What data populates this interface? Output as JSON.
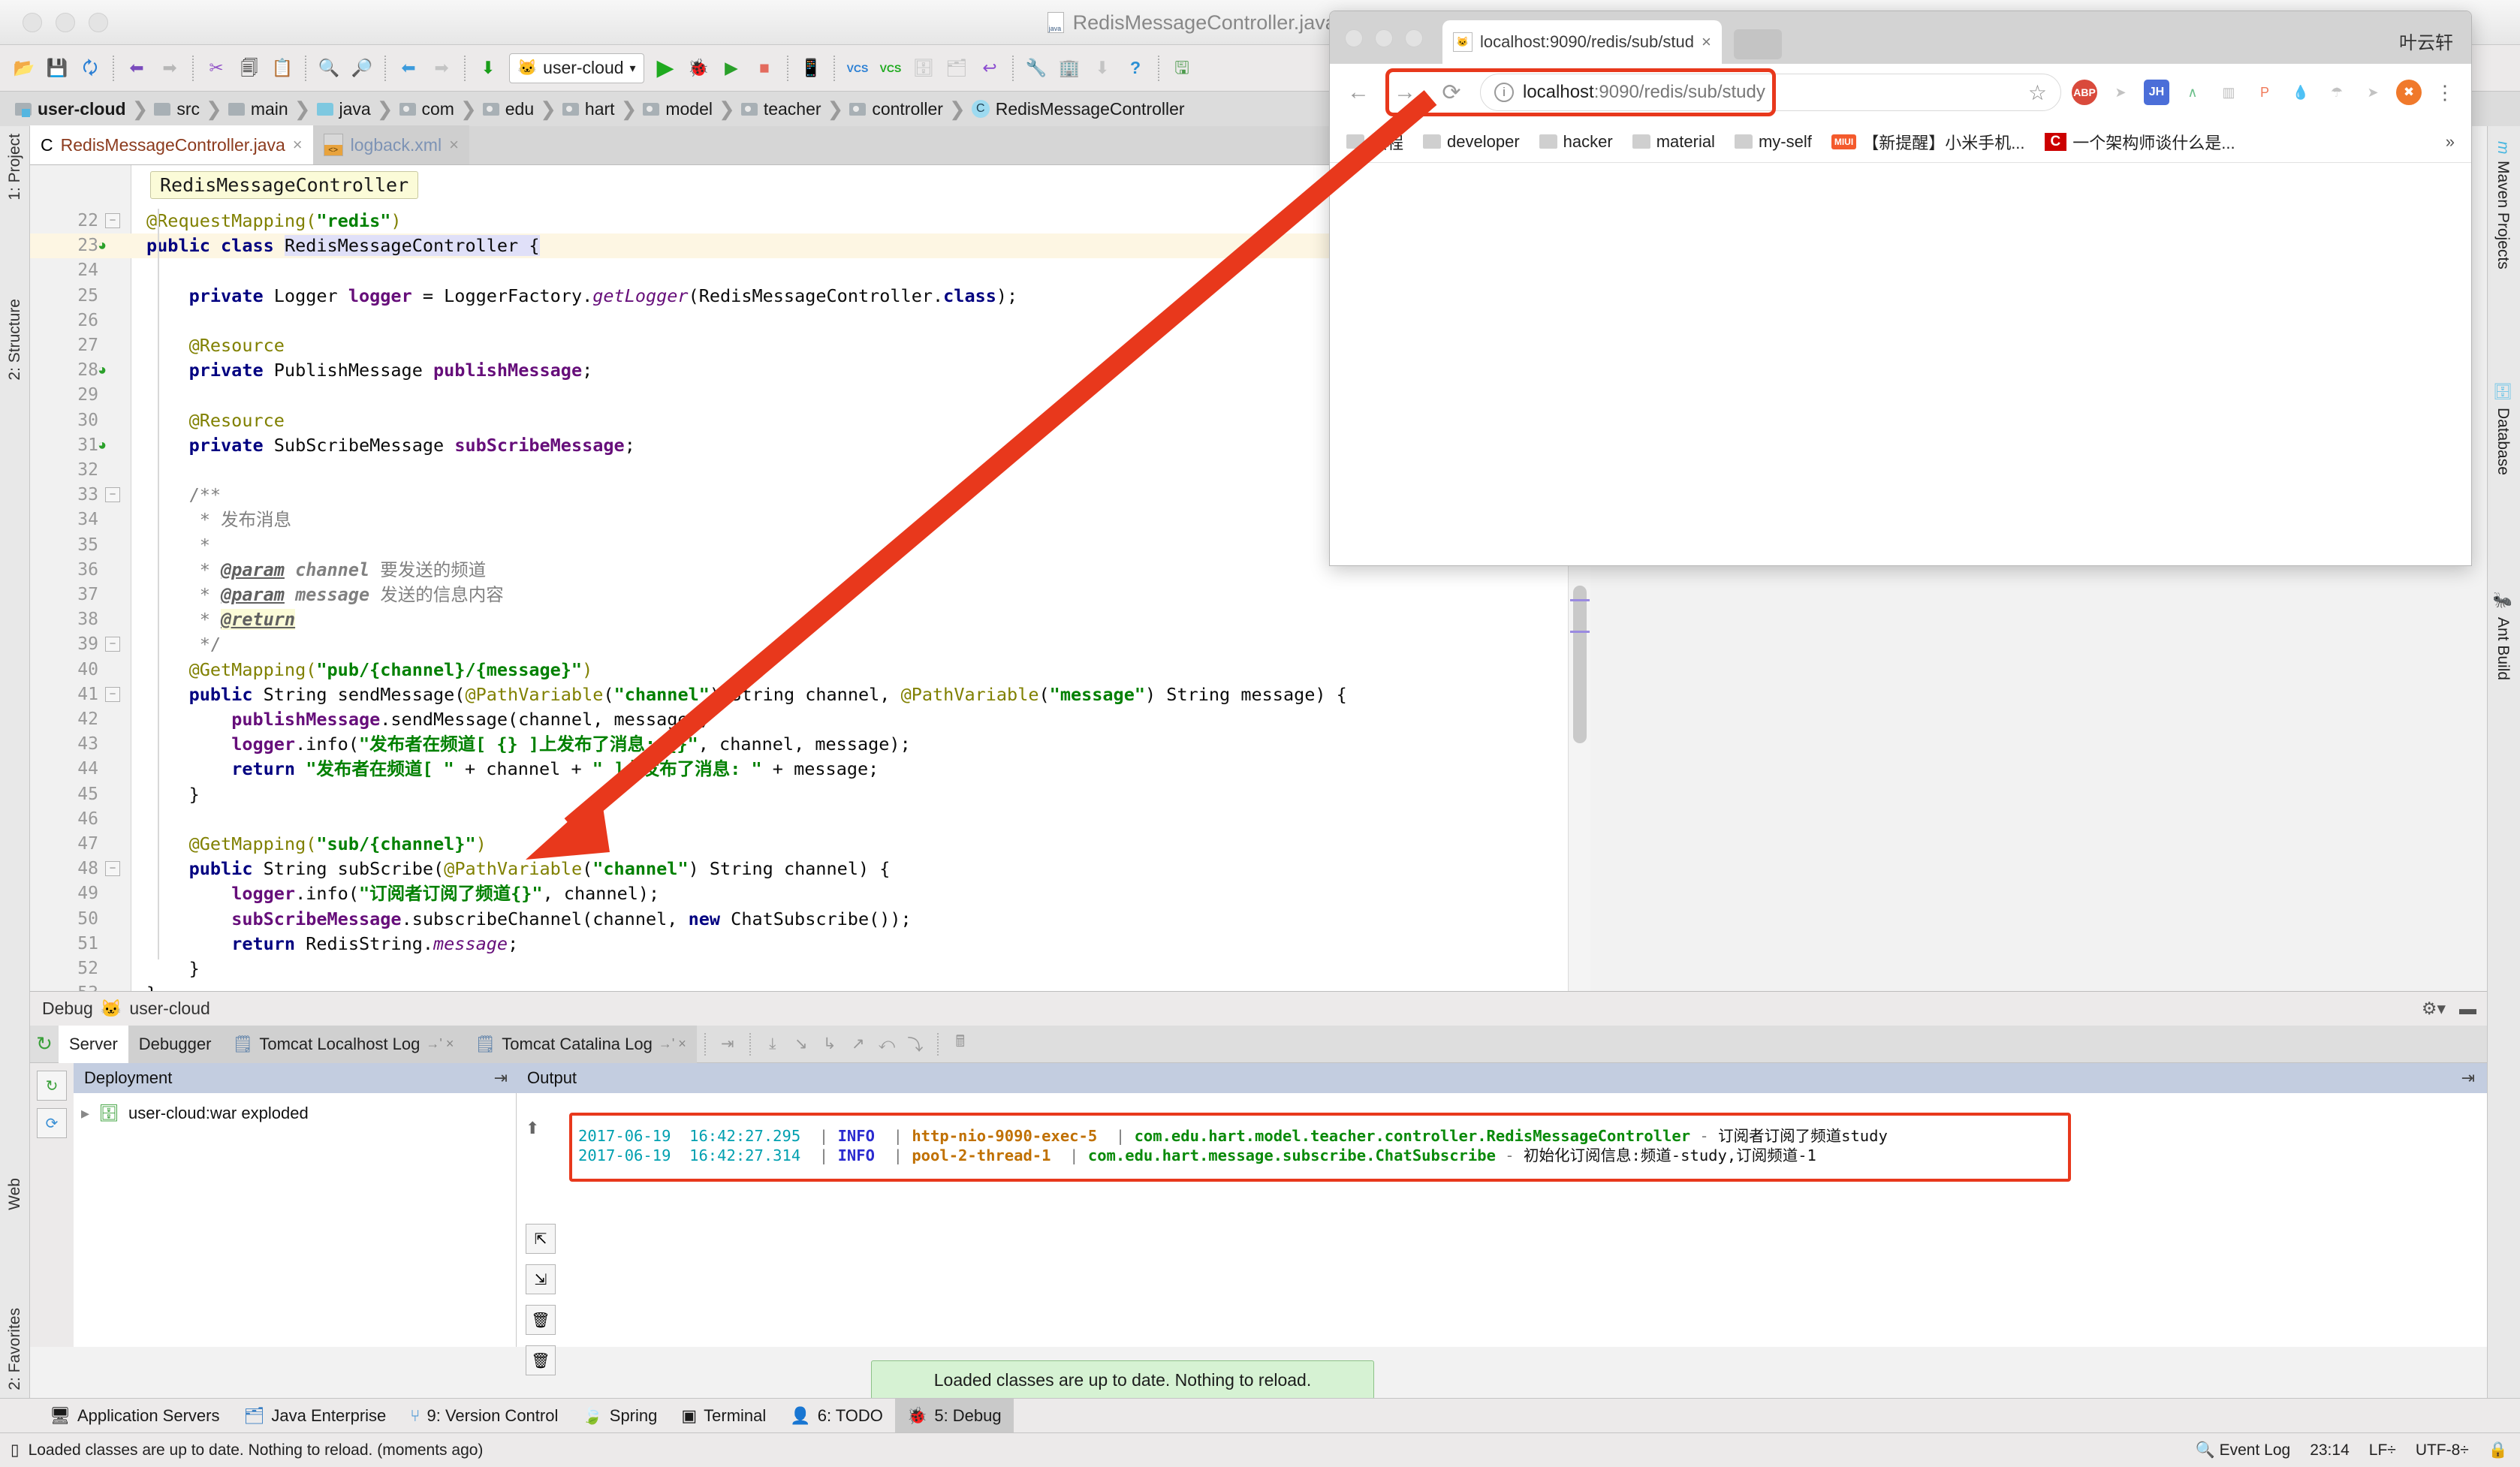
{
  "window": {
    "title": "RedisMessageController.java - user-cloud - [",
    "file_icon": "java-file-icon"
  },
  "toolbar": {
    "icons": [
      "open-folder-icon",
      "save-icon",
      "sync-icon",
      "undo-icon",
      "redo-icon",
      "cut-icon",
      "copy-icon",
      "paste-icon",
      "find-icon",
      "replace-icon",
      "back-icon",
      "forward-icon",
      "compile-icon"
    ],
    "module_selector": "user-cloud",
    "run_icon": "run-icon",
    "debug_icon": "debug-icon",
    "coverage_icon": "run-coverage-icon",
    "stop_icon": "stop-icon",
    "vcs_update_label": "VCS",
    "vcs_commit_label": "VCS",
    "help_icon": "help-icon"
  },
  "breadcrumb": {
    "items": [
      {
        "label": "user-cloud",
        "icon": "project-icon",
        "bold": true
      },
      {
        "label": "src",
        "icon": "folder-icon",
        "bold": false
      },
      {
        "label": "main",
        "icon": "folder-icon",
        "bold": false
      },
      {
        "label": "java",
        "icon": "source-folder-icon",
        "bold": false
      },
      {
        "label": "com",
        "icon": "package-icon",
        "bold": false
      },
      {
        "label": "edu",
        "icon": "package-icon",
        "bold": false
      },
      {
        "label": "hart",
        "icon": "package-icon",
        "bold": false
      },
      {
        "label": "model",
        "icon": "package-icon",
        "bold": false
      },
      {
        "label": "teacher",
        "icon": "package-icon",
        "bold": false
      },
      {
        "label": "controller",
        "icon": "package-icon",
        "bold": false
      },
      {
        "label": "RedisMessageController",
        "icon": "class-icon",
        "bold": false
      }
    ]
  },
  "left_rail": {
    "items": [
      "1: Project",
      "2: Structure",
      "2: Favorites",
      "Web"
    ]
  },
  "right_rail": {
    "items": [
      "Maven Projects",
      "Database",
      "Ant Build"
    ]
  },
  "editor": {
    "tabs": [
      {
        "label": "RedisMessageController.java",
        "icon": "java-class-icon",
        "active": true,
        "close": "×"
      },
      {
        "label": "logback.xml",
        "icon": "xml-file-icon",
        "active": false,
        "close": "×"
      }
    ],
    "breadcrumb_hint": "RedisMessageController",
    "lines": [
      {
        "n": "22",
        "indent": 1,
        "fold": "minus",
        "segs": [
          {
            "t": "@RequestMapping(",
            "c": "ann"
          },
          {
            "t": "\"redis\"",
            "c": "str"
          },
          {
            "t": ")",
            "c": "ann"
          }
        ]
      },
      {
        "n": "23",
        "highlight": true,
        "gmark": "class-marker-icon",
        "segs": [
          {
            "t": "public class ",
            "c": "kw"
          },
          {
            "t": "RedisMessageController {",
            "c": "sel"
          }
        ]
      },
      {
        "n": "24",
        "segs": []
      },
      {
        "n": "25",
        "segs": [
          {
            "t": "    ",
            "c": ""
          },
          {
            "t": "private ",
            "c": "kw"
          },
          {
            "t": "Logger ",
            "c": ""
          },
          {
            "t": "logger",
            "c": "fld"
          },
          {
            "t": " = LoggerFactory.",
            "c": ""
          },
          {
            "t": "getLogger",
            "c": "stat"
          },
          {
            "t": "(RedisMessageController.",
            "c": ""
          },
          {
            "t": "class",
            "c": "kw"
          },
          {
            "t": ");",
            "c": ""
          }
        ]
      },
      {
        "n": "26",
        "segs": []
      },
      {
        "n": "27",
        "segs": [
          {
            "t": "    @Resource",
            "c": "ann"
          }
        ]
      },
      {
        "n": "28",
        "gmark": "bean-marker-icon",
        "segs": [
          {
            "t": "    ",
            "c": ""
          },
          {
            "t": "private ",
            "c": "kw"
          },
          {
            "t": "PublishMessage ",
            "c": ""
          },
          {
            "t": "publishMessage",
            "c": "fld"
          },
          {
            "t": ";",
            "c": ""
          }
        ]
      },
      {
        "n": "29",
        "segs": []
      },
      {
        "n": "30",
        "segs": [
          {
            "t": "    @Resource",
            "c": "ann"
          }
        ]
      },
      {
        "n": "31",
        "gmark": "bean-marker-icon",
        "segs": [
          {
            "t": "    ",
            "c": ""
          },
          {
            "t": "private ",
            "c": "kw"
          },
          {
            "t": "SubScribeMessage ",
            "c": ""
          },
          {
            "t": "subScribeMessage",
            "c": "fld"
          },
          {
            "t": ";",
            "c": ""
          }
        ]
      },
      {
        "n": "32",
        "segs": []
      },
      {
        "n": "33",
        "fold": "minus",
        "segs": [
          {
            "t": "    /**",
            "c": "cmt"
          }
        ]
      },
      {
        "n": "34",
        "segs": [
          {
            "t": "     * 发布消息",
            "c": "cmt"
          }
        ]
      },
      {
        "n": "35",
        "segs": [
          {
            "t": "     *",
            "c": "cmt"
          }
        ]
      },
      {
        "n": "36",
        "segs": [
          {
            "t": "     * ",
            "c": "cmt"
          },
          {
            "t": "@param",
            "c": "cmt-tag"
          },
          {
            "t": " ",
            "c": "cmt"
          },
          {
            "t": "channel",
            "c": "cmt-b"
          },
          {
            "t": " 要发送的频道",
            "c": "cmt"
          }
        ]
      },
      {
        "n": "37",
        "segs": [
          {
            "t": "     * ",
            "c": "cmt"
          },
          {
            "t": "@param",
            "c": "cmt-tag"
          },
          {
            "t": " ",
            "c": "cmt"
          },
          {
            "t": "message",
            "c": "cmt-b"
          },
          {
            "t": " 发送的信息内容",
            "c": "cmt"
          }
        ]
      },
      {
        "n": "38",
        "segs": [
          {
            "t": "     * ",
            "c": "cmt"
          },
          {
            "t": "@return",
            "c": "cmt-tag-hl"
          }
        ]
      },
      {
        "n": "39",
        "fold": "minus",
        "segs": [
          {
            "t": "     */",
            "c": "cmt"
          }
        ]
      },
      {
        "n": "40",
        "segs": [
          {
            "t": "    @GetMapping(",
            "c": "ann"
          },
          {
            "t": "\"pub/{channel}/{message}\"",
            "c": "str"
          },
          {
            "t": ")",
            "c": "ann"
          }
        ]
      },
      {
        "n": "41",
        "fold": "minus",
        "segs": [
          {
            "t": "    ",
            "c": ""
          },
          {
            "t": "public ",
            "c": "kw"
          },
          {
            "t": "String sendMessage(",
            "c": ""
          },
          {
            "t": "@PathVariable",
            "c": "ann"
          },
          {
            "t": "(",
            "c": ""
          },
          {
            "t": "\"channel\"",
            "c": "str"
          },
          {
            "t": ") String channel, ",
            "c": ""
          },
          {
            "t": "@PathVariable",
            "c": "ann"
          },
          {
            "t": "(",
            "c": ""
          },
          {
            "t": "\"message\"",
            "c": "str"
          },
          {
            "t": ") String message) {",
            "c": ""
          }
        ]
      },
      {
        "n": "42",
        "segs": [
          {
            "t": "        ",
            "c": ""
          },
          {
            "t": "publishMessage",
            "c": "fld"
          },
          {
            "t": ".sendMessage(channel, message);",
            "c": ""
          }
        ]
      },
      {
        "n": "43",
        "segs": [
          {
            "t": "        ",
            "c": ""
          },
          {
            "t": "logger",
            "c": "fld"
          },
          {
            "t": ".info(",
            "c": ""
          },
          {
            "t": "\"发布者在频道[ {} ]上发布了消息: {}\"",
            "c": "str"
          },
          {
            "t": ", channel, message);",
            "c": ""
          }
        ]
      },
      {
        "n": "44",
        "segs": [
          {
            "t": "        ",
            "c": ""
          },
          {
            "t": "return ",
            "c": "kw"
          },
          {
            "t": "\"发布者在频道[ \"",
            "c": "str"
          },
          {
            "t": " + channel + ",
            "c": ""
          },
          {
            "t": "\" ]上发布了消息: \"",
            "c": "str"
          },
          {
            "t": " + message;",
            "c": ""
          }
        ]
      },
      {
        "n": "45",
        "segs": [
          {
            "t": "    }",
            "c": ""
          }
        ]
      },
      {
        "n": "46",
        "segs": []
      },
      {
        "n": "47",
        "segs": [
          {
            "t": "    @GetMapping(",
            "c": "ann"
          },
          {
            "t": "\"sub/{channel}\"",
            "c": "str"
          },
          {
            "t": ")",
            "c": "ann"
          }
        ]
      },
      {
        "n": "48",
        "fold": "minus",
        "segs": [
          {
            "t": "    ",
            "c": ""
          },
          {
            "t": "public ",
            "c": "kw"
          },
          {
            "t": "String subScribe(",
            "c": ""
          },
          {
            "t": "@PathVariable",
            "c": "ann"
          },
          {
            "t": "(",
            "c": ""
          },
          {
            "t": "\"channel\"",
            "c": "str"
          },
          {
            "t": ") String channel) {",
            "c": ""
          }
        ]
      },
      {
        "n": "49",
        "segs": [
          {
            "t": "        ",
            "c": ""
          },
          {
            "t": "logger",
            "c": "fld"
          },
          {
            "t": ".info(",
            "c": ""
          },
          {
            "t": "\"订阅者订阅了频道{}\"",
            "c": "str"
          },
          {
            "t": ", channel);",
            "c": ""
          }
        ]
      },
      {
        "n": "50",
        "segs": [
          {
            "t": "        ",
            "c": ""
          },
          {
            "t": "subScribeMessage",
            "c": "fld"
          },
          {
            "t": ".subscribeChannel(channel, ",
            "c": ""
          },
          {
            "t": "new ",
            "c": "kw"
          },
          {
            "t": "ChatSubscribe());",
            "c": ""
          }
        ]
      },
      {
        "n": "51",
        "segs": [
          {
            "t": "        ",
            "c": ""
          },
          {
            "t": "return ",
            "c": "kw"
          },
          {
            "t": "RedisString.",
            "c": ""
          },
          {
            "t": "message",
            "c": "stat"
          },
          {
            "t": ";",
            "c": ""
          }
        ]
      },
      {
        "n": "52",
        "segs": [
          {
            "t": "    }",
            "c": ""
          }
        ]
      },
      {
        "n": "53",
        "segs": [
          {
            "t": "}",
            "c": ""
          }
        ]
      }
    ]
  },
  "debug": {
    "header": "Debug",
    "header_config": "user-cloud",
    "tabs": [
      {
        "label": "Server",
        "active": true,
        "icon": null
      },
      {
        "label": "Debugger",
        "active": false,
        "icon": null
      },
      {
        "label": "Tomcat Localhost Log",
        "active": false,
        "icon": "log-icon",
        "suffix": "→' ×"
      },
      {
        "label": "Tomcat Catalina Log",
        "active": false,
        "icon": "log-icon",
        "suffix": "→' ×"
      }
    ],
    "deployment_header": "Deployment",
    "output_header": "Output",
    "deployment_item": "user-cloud:war exploded",
    "log_lines": [
      {
        "ts": "2017-06-19  16:42:27.295",
        "level": "INFO",
        "thread": "http-nio-9090-exec-5",
        "logger": "com.edu.hart.model.teacher.controller.RedisMessageController",
        "message": "订阅者订阅了频道study"
      },
      {
        "ts": "2017-06-19  16:42:27.314",
        "level": "INFO",
        "thread": "pool-2-thread-1",
        "logger": "com.edu.hart.message.subscribe.ChatSubscribe",
        "message": "初始化订阅信息:频道-study,订阅频道-1"
      }
    ]
  },
  "toast": {
    "message": "Loaded classes are up to date. Nothing to reload."
  },
  "tool_strip": {
    "items": [
      {
        "label": "Application Servers",
        "icon": "app-servers-icon",
        "active": false
      },
      {
        "label": "Java Enterprise",
        "icon": "java-ee-icon",
        "active": false
      },
      {
        "label": "9: Version Control",
        "icon": "vcs-icon",
        "active": false,
        "mnemonic": "9"
      },
      {
        "label": "Spring",
        "icon": "spring-icon",
        "active": false
      },
      {
        "label": "Terminal",
        "icon": "terminal-icon",
        "active": false
      },
      {
        "label": "6: TODO",
        "icon": "todo-icon",
        "active": false,
        "mnemonic": "6"
      },
      {
        "label": "5: Debug",
        "icon": "debug-icon",
        "active": true,
        "mnemonic": "5"
      }
    ]
  },
  "status_bar": {
    "message": "Loaded classes are up to date. Nothing to reload. (moments ago)",
    "event_log": "Event Log",
    "time": "23:14",
    "line_sep": "LF÷",
    "encoding": "UTF-8÷"
  },
  "browser": {
    "user": "叶云轩",
    "tab": {
      "title": "localhost:9090/redis/sub/stud",
      "favicon": "tomcat-favicon",
      "close": "×"
    },
    "nav": {
      "back": "←",
      "forward": "→",
      "reload": "⟳",
      "star": "☆",
      "menu": "⋮"
    },
    "url_host": "localhost",
    "url_path": ":9090/redis/sub/study",
    "url_full": "localhost:9090/redis/sub/study",
    "extensions": [
      "ABP",
      "➤",
      "JH",
      "∧",
      "‖",
      "P",
      "●",
      "☂",
      "➤",
      "✖"
    ],
    "bookmarks": [
      {
        "label": "教程",
        "icon": "folder-icon"
      },
      {
        "label": "developer",
        "icon": "folder-icon"
      },
      {
        "label": "hacker",
        "icon": "folder-icon"
      },
      {
        "label": "material",
        "icon": "folder-icon"
      },
      {
        "label": "my-self",
        "icon": "folder-icon"
      },
      {
        "label": "【新提醒】小米手机...",
        "icon": "miui-icon"
      },
      {
        "label": "一个架构师谈什么是...",
        "icon": "csdn-icon"
      }
    ],
    "overflow": "»"
  },
  "colors": {
    "accent_red": "#e8381c",
    "toast_green": "#d6f2d3",
    "keyword_blue": "#000080",
    "string_green": "#008000",
    "annotation_olive": "#808000",
    "field_purple": "#660e7a"
  }
}
